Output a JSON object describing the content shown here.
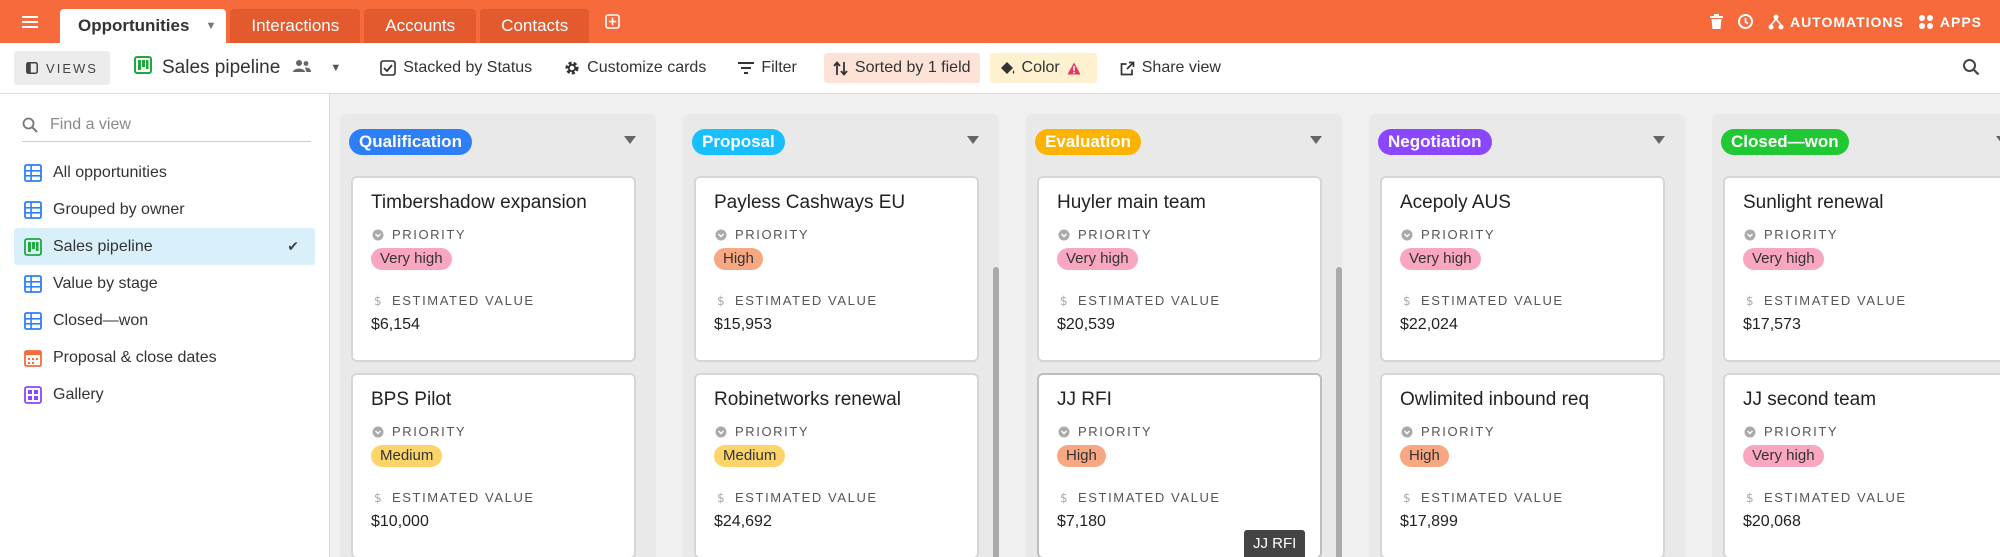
{
  "tabs": [
    {
      "label": "Opportunities",
      "active": true
    },
    {
      "label": "Interactions",
      "active": false
    },
    {
      "label": "Accounts",
      "active": false
    },
    {
      "label": "Contacts",
      "active": false
    }
  ],
  "topbar": {
    "automations_label": "AUTOMATIONS",
    "apps_label": "APPS",
    "icons": [
      "trash-icon",
      "history-icon",
      "automations-icon",
      "apps-icon"
    ]
  },
  "toolbar": {
    "views_label": "VIEWS",
    "view_title": "Sales pipeline",
    "stacked": "Stacked by Status",
    "customize": "Customize cards",
    "filter": "Filter",
    "sorted": "Sorted by 1 field",
    "color": "Color",
    "share": "Share view"
  },
  "sidebar": {
    "search_placeholder": "Find a view",
    "items": [
      {
        "label": "All opportunities",
        "icon": "grid-view-icon",
        "active": false
      },
      {
        "label": "Grouped by owner",
        "icon": "grid-view-icon",
        "active": false
      },
      {
        "label": "Sales pipeline",
        "icon": "kanban-view-icon",
        "active": true
      },
      {
        "label": "Value by stage",
        "icon": "grid-view-icon",
        "active": false
      },
      {
        "label": "Closed—won",
        "icon": "grid-view-icon",
        "active": false
      },
      {
        "label": "Proposal & close dates",
        "icon": "calendar-view-icon",
        "active": false
      },
      {
        "label": "Gallery",
        "icon": "gallery-view-icon",
        "active": false
      }
    ]
  },
  "field_labels": {
    "priority": "PRIORITY",
    "value": "ESTIMATED VALUE"
  },
  "priority_colors": {
    "Very high": "#f9a7c0",
    "High": "#f7a882",
    "Medium": "#fcd46a"
  },
  "stacks": [
    {
      "status": "Qualification",
      "color": "#2d7ff9",
      "cards": [
        {
          "name": "Timbershadow expansion",
          "priority": "Very high",
          "value": "$6,154"
        },
        {
          "name": "BPS Pilot",
          "priority": "Medium",
          "value": "$10,000"
        }
      ]
    },
    {
      "status": "Proposal",
      "color": "#18bfff",
      "cards": [
        {
          "name": "Payless Cashways EU",
          "priority": "High",
          "value": "$15,953"
        },
        {
          "name": "Robinetworks renewal",
          "priority": "Medium",
          "value": "$24,692"
        }
      ]
    },
    {
      "status": "Evaluation",
      "color": "#fcb400",
      "cards": [
        {
          "name": "Huyler main team",
          "priority": "Very high",
          "value": "$20,539"
        },
        {
          "name": "JJ RFI",
          "priority": "High",
          "value": "$7,180"
        }
      ]
    },
    {
      "status": "Negotiation",
      "color": "#8b46ff",
      "cards": [
        {
          "name": "Acepoly AUS",
          "priority": "Very high",
          "value": "$22,024"
        },
        {
          "name": "Owlimited inbound req",
          "priority": "High",
          "value": "$17,899"
        }
      ]
    },
    {
      "status": "Closed—won",
      "color": "#20c933",
      "cards": [
        {
          "name": "Sunlight renewal",
          "priority": "Very high",
          "value": "$17,573"
        },
        {
          "name": "JJ second team",
          "priority": "Very high",
          "value": "$20,068"
        }
      ]
    }
  ],
  "tooltip": "JJ RFI"
}
